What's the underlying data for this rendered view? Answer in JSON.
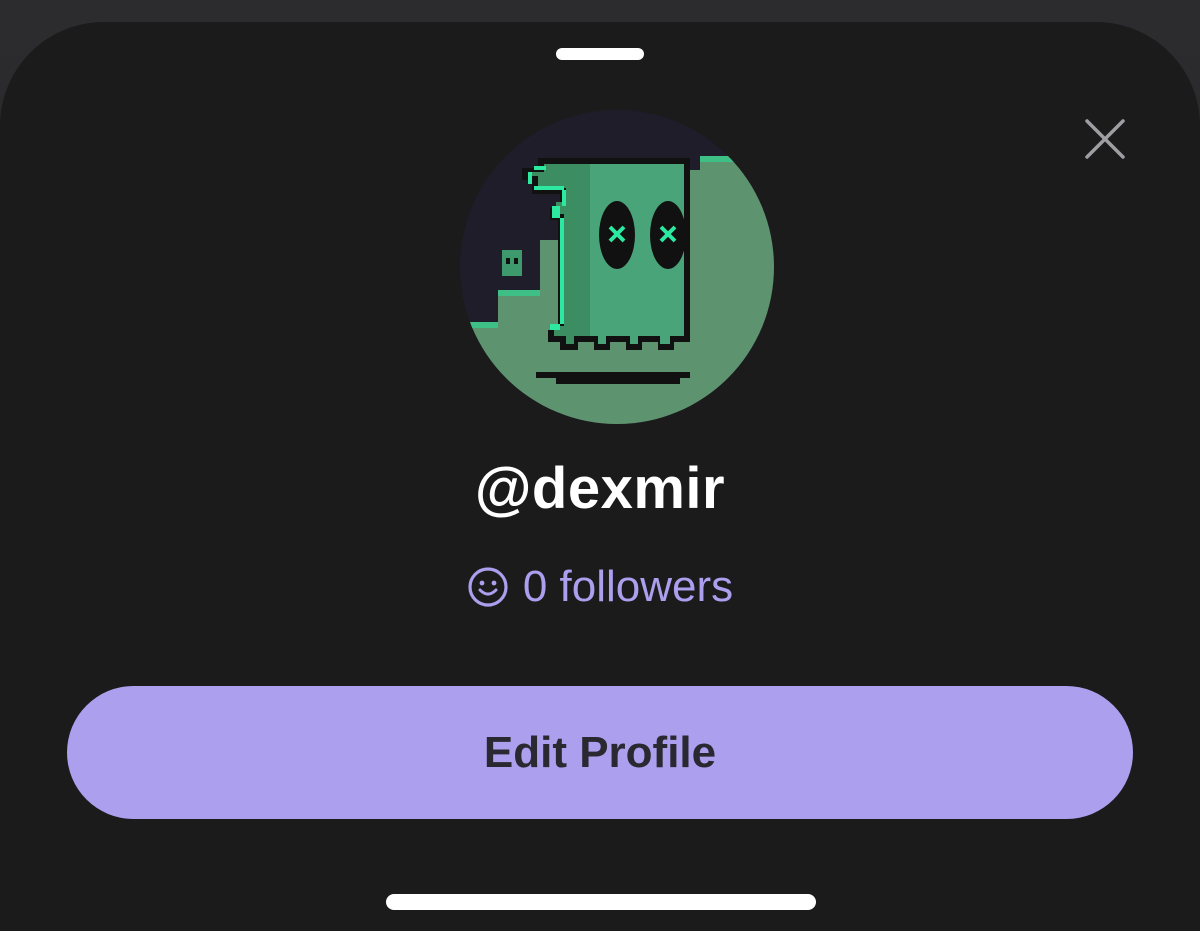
{
  "profile": {
    "handle": "@dexmir",
    "followers_label": "0 followers",
    "avatar_icon": "pixel-ghost-avatar"
  },
  "actions": {
    "edit_profile_label": "Edit Profile"
  },
  "icons": {
    "close": "close-icon",
    "followers": "smiley-icon"
  },
  "colors": {
    "sheet_background": "#1b1b1c",
    "accent": "#ab9fee",
    "button_text": "#2a2830",
    "text_primary": "#ffffff"
  }
}
